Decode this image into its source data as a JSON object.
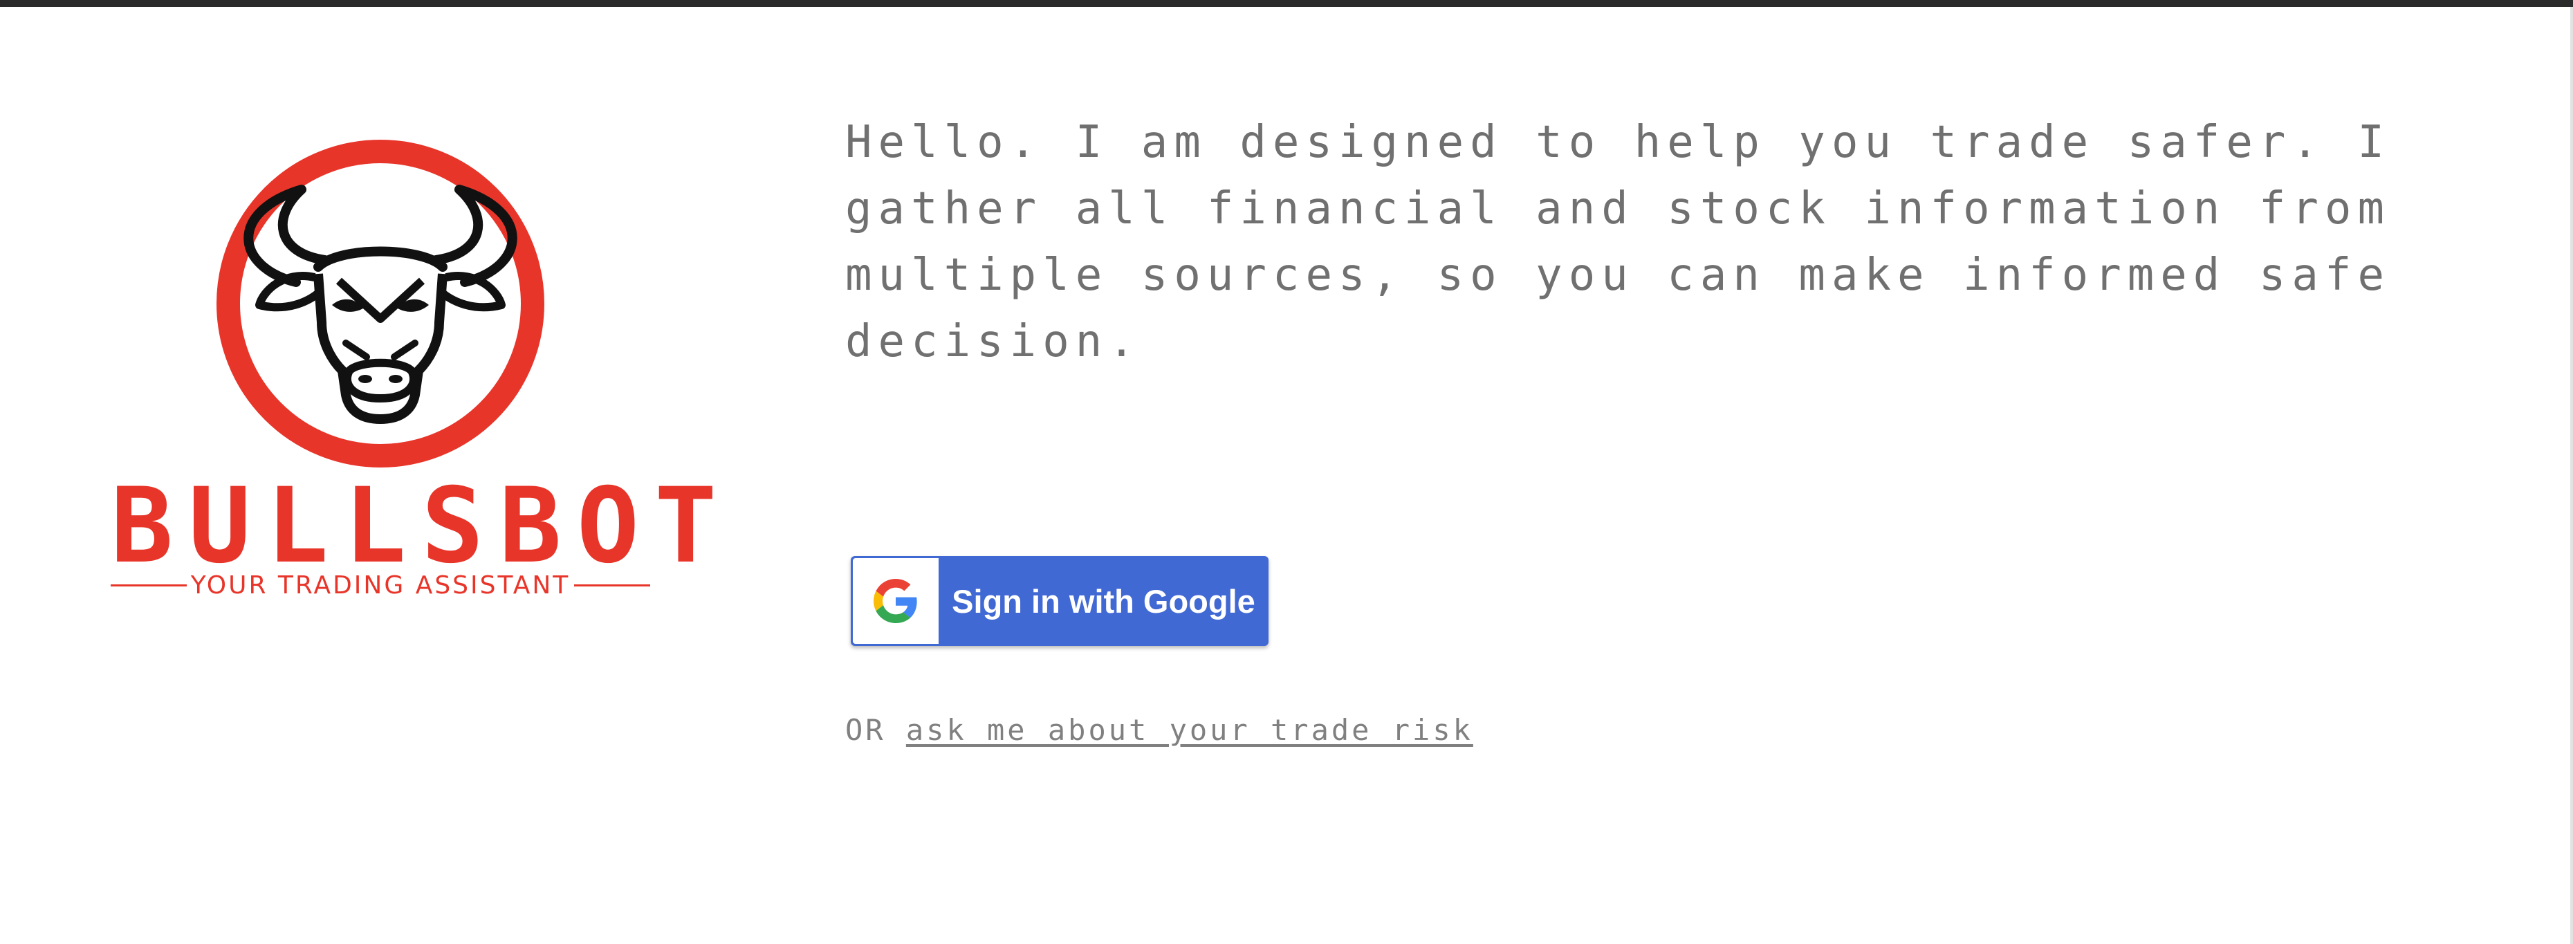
{
  "brand": {
    "name": "BULLSBOT",
    "tagline": "YOUR TRADING ASSISTANT",
    "accent_color": "#e8352a",
    "logo_icon": "bull-head-icon"
  },
  "intro": {
    "text": "Hello. I am designed to help you trade safer. I gather all financial and stock information from multiple sources, so you can make informed safe decision."
  },
  "auth": {
    "google_button_label": "Sign in with Google",
    "google_button_color": "#4169d4",
    "google_icon": "google-g-icon"
  },
  "alternative": {
    "prefix": "OR",
    "link_label": "ask me about your trade risk"
  }
}
